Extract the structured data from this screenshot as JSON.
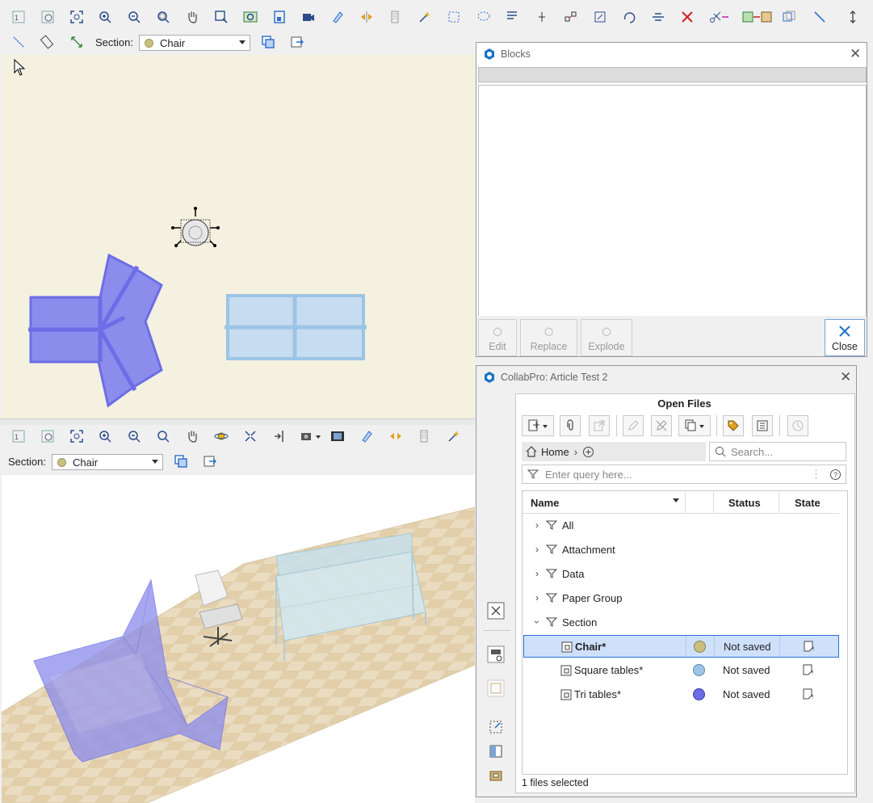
{
  "top_view": {
    "toolbar_icons": [
      "zoom-1-1-icon",
      "zoom-previous-icon",
      "zoom-extents-icon",
      "zoom-in-icon",
      "zoom-out-icon",
      "zoom-window-icon",
      "pan-hand-icon",
      "zoom-selection-icon",
      "zoom-fit-icon",
      "frame-icon",
      "camera-icon",
      "snap-icon",
      "mirror-icon",
      "hatch-icon",
      "sparkle-icon",
      "select-box-icon",
      "lasso-icon",
      "text-icon",
      "pin-icon",
      "connect-icon",
      "scale-icon",
      "rotate-icon",
      "align-icon",
      "delete-icon",
      "cut-icon",
      "replace-icon",
      "swap-icon",
      "line-icon",
      "resize-vertical-icon"
    ],
    "toolbar_icons_row2": [
      "diagonal-line-icon",
      "measure-icon",
      "dimension-icon"
    ],
    "section_label": "Section:",
    "section_value": "Chair",
    "section_color": "#c8c07c"
  },
  "view3d": {
    "toolbar_icons": [
      "zoom-1-1-icon",
      "zoom-previous-icon",
      "zoom-extents-icon",
      "zoom-in-icon",
      "zoom-out-icon",
      "zoom-window-icon",
      "pan-hand-icon",
      "orbit-icon",
      "fullscreen-icon",
      "walk-icon",
      "camera-icon",
      "film-icon",
      "snap-icon",
      "mirror-icon",
      "hatch-icon",
      "sparkle-icon"
    ],
    "section_label": "Section:",
    "section_value": "Chair"
  },
  "blocks_panel": {
    "title": "Blocks",
    "buttons": [
      {
        "label": "Edit",
        "icon": "cube-icon"
      },
      {
        "label": "Replace",
        "icon": "cube-icon"
      },
      {
        "label": "Explode",
        "icon": "cube-icon"
      }
    ],
    "close_label": "Close"
  },
  "collabpro": {
    "title": "CollabPro: Article Test 2",
    "open_files_heading": "Open Files",
    "breadcrumb_home": "Home",
    "search_placeholder": "Search...",
    "query_placeholder": "Enter query here...",
    "columns": {
      "name": "Name",
      "status": "Status",
      "state": "State"
    },
    "tree": [
      {
        "label": "All",
        "expanded": false
      },
      {
        "label": "Attachment",
        "expanded": false
      },
      {
        "label": "Data",
        "expanded": false
      },
      {
        "label": "Paper Group",
        "expanded": false
      },
      {
        "label": "Section",
        "expanded": true
      }
    ],
    "files": [
      {
        "name": "Chair*",
        "color": "#c8c07c",
        "status": "Not saved",
        "selected": true
      },
      {
        "name": "Square tables*",
        "color": "#9cc4e4",
        "status": "Not saved",
        "selected": false
      },
      {
        "name": "Tri tables*",
        "color": "#6d6de6",
        "status": "Not saved",
        "selected": false
      }
    ],
    "footer": "1 files selected"
  },
  "colors": {
    "accent": "#1a73c8",
    "selected_row": "#cfe0fb",
    "selected_border": "#2a6fd6",
    "tri_table": "#8c8ced",
    "square_table": "#c6dcf0",
    "plan_bg": "#f4f1e0"
  }
}
